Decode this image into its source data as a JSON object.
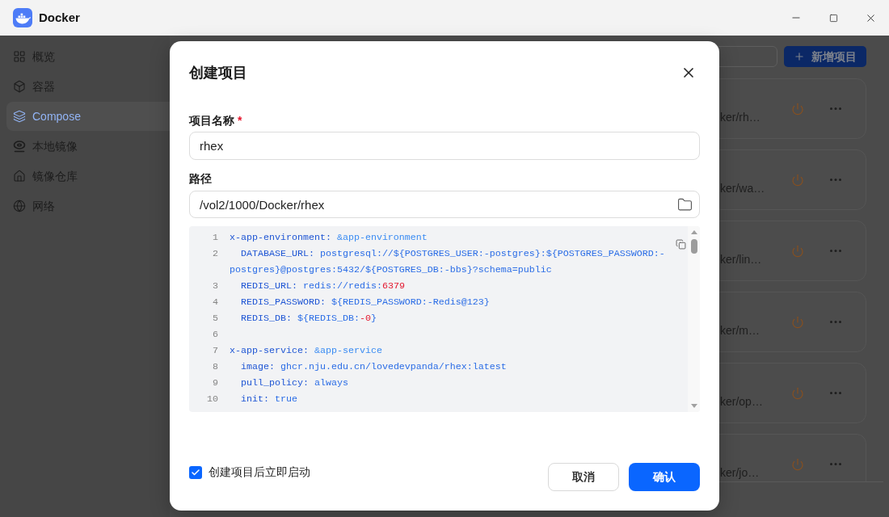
{
  "window": {
    "title": "Docker"
  },
  "sidebar": {
    "items": [
      {
        "label": "概览",
        "selected": false
      },
      {
        "label": "容器",
        "selected": false
      },
      {
        "label": "Compose",
        "selected": true
      },
      {
        "label": "本地镜像",
        "selected": false
      },
      {
        "label": "镜像仓库",
        "selected": false
      },
      {
        "label": "网络",
        "selected": false
      }
    ]
  },
  "toolbar": {
    "add_button": "新增项目"
  },
  "projects": [
    {
      "path": "ker/rh…"
    },
    {
      "path": "ker/wa…"
    },
    {
      "path": "ker/lin…"
    },
    {
      "path": "ker/m…"
    },
    {
      "path": "ker/op…"
    },
    {
      "path": "ker/jo…"
    }
  ],
  "dialog": {
    "title": "创建项目",
    "name_field": {
      "label": "项目名称",
      "required_mark": "*",
      "value": "rhex"
    },
    "path_field": {
      "label": "路径",
      "value": "/vol2/1000/Docker/rhex"
    },
    "editor": {
      "lines": [
        {
          "number": "1",
          "tokens": [
            {
              "kind": "key",
              "text": "x-app-environment:"
            },
            {
              "kind": "anchor",
              "text": " &app-environment"
            }
          ]
        },
        {
          "number": "2",
          "tokens": [
            {
              "kind": "key",
              "text": "  DATABASE_URL:"
            },
            {
              "kind": "value",
              "text": " postgresql://${POSTGRES_USER:-postgres}:${POSTGRES_PASSWORD:-postgres}@postgres:5432/${POSTGRES_DB:-bbs}?schema=public"
            }
          ]
        },
        {
          "number": "3",
          "tokens": [
            {
              "kind": "key",
              "text": "  REDIS_URL:"
            },
            {
              "kind": "value",
              "text": " redis://redis:"
            },
            {
              "kind": "number",
              "text": "6379"
            }
          ]
        },
        {
          "number": "4",
          "tokens": [
            {
              "kind": "key",
              "text": "  REDIS_PASSWORD:"
            },
            {
              "kind": "value",
              "text": " ${REDIS_PASSWORD:-Redis@123}"
            }
          ]
        },
        {
          "number": "5",
          "tokens": [
            {
              "kind": "key",
              "text": "  REDIS_DB:"
            },
            {
              "kind": "value",
              "text": " ${REDIS_DB:"
            },
            {
              "kind": "number",
              "text": "-0"
            },
            {
              "kind": "value",
              "text": "}"
            }
          ]
        },
        {
          "number": "6"
        },
        {
          "number": "7",
          "tokens": [
            {
              "kind": "key",
              "text": "x-app-service:"
            },
            {
              "kind": "anchor",
              "text": " &app-service"
            }
          ]
        },
        {
          "number": "8",
          "tokens": [
            {
              "kind": "key",
              "text": "  image:"
            },
            {
              "kind": "value",
              "text": " ghcr.nju.edu.cn/lovedevpanda/rhex:latest"
            }
          ]
        },
        {
          "number": "9",
          "tokens": [
            {
              "kind": "key",
              "text": "  pull_policy:"
            },
            {
              "kind": "value",
              "text": " always"
            }
          ]
        },
        {
          "number": "10",
          "tokens": [
            {
              "kind": "key",
              "text": "  init:"
            },
            {
              "kind": "value",
              "text": " true"
            }
          ]
        }
      ]
    },
    "start_after_create": {
      "label": "创建项目后立即启动",
      "checked": true
    },
    "buttons": {
      "cancel": "取消",
      "confirm": "确认"
    }
  }
}
